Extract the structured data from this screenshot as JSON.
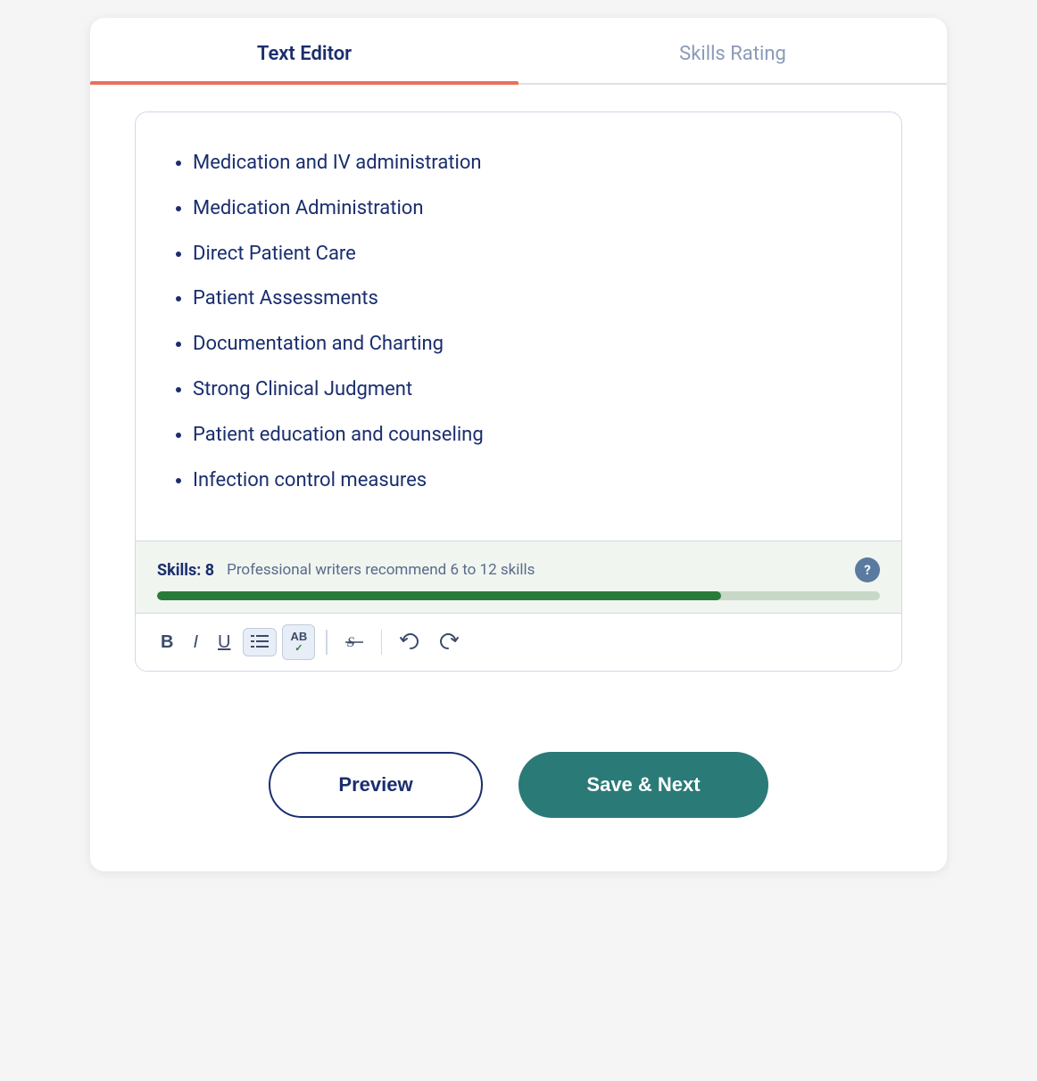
{
  "tabs": {
    "text_editor": "Text Editor",
    "skills_rating": "Skills Rating"
  },
  "editor": {
    "skills": [
      "Medication and IV administration",
      "Medication Administration",
      "Direct Patient Care",
      "Patient Assessments",
      "Documentation and Charting",
      "Strong Clinical Judgment",
      "Patient education and counseling",
      "Infection control measures"
    ]
  },
  "skills_bar": {
    "label": "Skills: 8",
    "recommendation": "Professional writers recommend 6 to 12 skills",
    "progress_percent": 78,
    "help_tooltip": "?"
  },
  "toolbar": {
    "bold": "B",
    "italic": "I",
    "underline": "U",
    "list": "≡",
    "ab_check": "AB",
    "checkmark": "✓",
    "strikethrough": "S̶",
    "undo": "↺",
    "redo": "↻"
  },
  "buttons": {
    "preview": "Preview",
    "save_next": "Save & Next"
  }
}
